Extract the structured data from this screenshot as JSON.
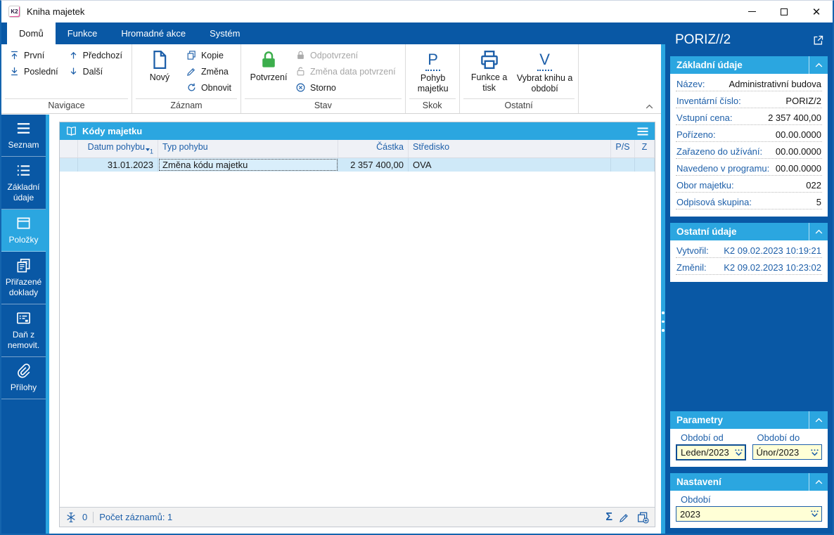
{
  "window": {
    "title": "Kniha majetek",
    "app_badge": "K2"
  },
  "menu": {
    "tabs": [
      {
        "label": "Domů",
        "active": true
      },
      {
        "label": "Funkce"
      },
      {
        "label": "Hromadné akce"
      },
      {
        "label": "Systém"
      }
    ]
  },
  "ribbon": {
    "groups": [
      {
        "label": "Navigace",
        "buttons": [
          {
            "label": "První",
            "icon": "arrow-up-bar-icon"
          },
          {
            "label": "Předchozí",
            "icon": "arrow-up-icon"
          },
          {
            "label": "Poslední",
            "icon": "arrow-down-bar-icon"
          },
          {
            "label": "Další",
            "icon": "arrow-down-icon"
          }
        ]
      },
      {
        "label": "Záznam",
        "buttons": [
          {
            "label": "Nový",
            "icon": "new-document-icon"
          },
          {
            "label": "Kopie",
            "icon": "copy-icon"
          },
          {
            "label": "Změna",
            "icon": "edit-pencil-icon"
          },
          {
            "label": "Obnovit",
            "icon": "refresh-icon"
          }
        ]
      },
      {
        "label": "Stav",
        "buttons": [
          {
            "label": "Potvrzení",
            "icon": "lock-closed-green-icon"
          },
          {
            "label": "Odpotvrzení",
            "icon": "lock-closed-gray-icon",
            "disabled": true
          },
          {
            "label": "Změna data potvrzení",
            "icon": "lock-open-gray-icon",
            "disabled": true
          },
          {
            "label": "Storno",
            "icon": "cancel-circle-icon"
          }
        ]
      },
      {
        "label": "Skok",
        "buttons": [
          {
            "label": "Pohyb majetku",
            "icon_letter": "P"
          }
        ]
      },
      {
        "label": "Ostatní",
        "buttons": [
          {
            "label": "Funkce a tisk",
            "icon": "printer-icon"
          },
          {
            "label": "Vybrat knihu a období",
            "icon_letter": "V"
          }
        ]
      }
    ]
  },
  "sidebar": {
    "items": [
      {
        "label": "Seznam",
        "icon": "menu-icon"
      },
      {
        "label": "Základní údaje",
        "icon": "list-icon"
      },
      {
        "label": "Položky",
        "icon": "items-icon",
        "active": true
      },
      {
        "label": "Přiřazené doklady",
        "icon": "documents-icon"
      },
      {
        "label": "Daň z nemovit.",
        "icon": "tax-form-icon"
      },
      {
        "label": "Přílohy",
        "icon": "paperclip-icon"
      }
    ]
  },
  "table": {
    "title": "Kódy majetku",
    "sort_indicator": "1",
    "columns": {
      "datum": "Datum pohybu",
      "typ": "Typ pohybu",
      "castka": "Částka",
      "stredisko": "Středisko",
      "ps": "P/S",
      "z": "Z"
    },
    "rows": [
      {
        "datum": "31.01.2023",
        "typ": "Změna kódu majetku",
        "castka": "2 357 400,00",
        "stredisko": "OVA",
        "ps": "",
        "z": ""
      }
    ],
    "status": {
      "flag_count": "0",
      "record_count_label": "Počet záznamů: 1"
    }
  },
  "detail": {
    "title": "PORIZ//2",
    "sections": {
      "zakladni": {
        "title": "Základní údaje",
        "fields": [
          {
            "label": "Název:",
            "value": "Administrativní budova"
          },
          {
            "label": "Inventární číslo:",
            "value": "PORIZ/2"
          },
          {
            "label": "Vstupní cena:",
            "value": "2 357 400,00"
          },
          {
            "label": "Pořízeno:",
            "value": "00.00.0000"
          },
          {
            "label": "Zařazeno do užívání:",
            "value": "00.00.0000"
          },
          {
            "label": "Navedeno v programu:",
            "value": "00.00.0000"
          },
          {
            "label": "Obor majetku:",
            "value": "022"
          },
          {
            "label": "Odpisová skupina:",
            "value": "5"
          }
        ]
      },
      "ostatni": {
        "title": "Ostatní údaje",
        "fields": [
          {
            "label": "Vytvořil:",
            "value": "K2 09.02.2023 10:19:21"
          },
          {
            "label": "Změnil:",
            "value": "K2 09.02.2023 10:23:02"
          }
        ]
      },
      "parametry": {
        "title": "Parametry",
        "inputs": [
          {
            "label": "Období od",
            "value": "Leden/2023"
          },
          {
            "label": "Období do",
            "value": "Únor/2023"
          }
        ]
      },
      "nastaveni": {
        "title": "Nastavení",
        "inputs": [
          {
            "label": "Období",
            "value": "2023"
          }
        ]
      }
    }
  },
  "colors": {
    "primary_blue": "#0958A5",
    "accent_cyan": "#2BA6E0",
    "icon_blue": "#1D5FA9",
    "confirm_green": "#3CAE4C",
    "input_yellow": "#FFFFD6",
    "selected_row": "#CFE9F8"
  }
}
